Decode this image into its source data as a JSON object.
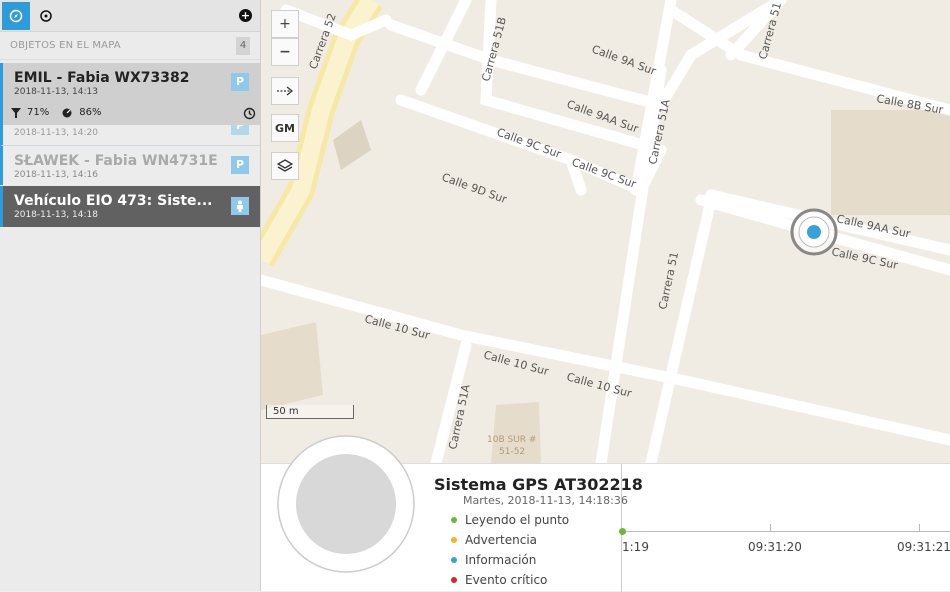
{
  "sidebar": {
    "section_label": "OBJETOS EN EL MAPA",
    "count": "4",
    "items": [
      {
        "name": "EMIL - Fabia WX73382",
        "time": "2018-11-13, 14:13",
        "badge": "P",
        "signal": "71%",
        "battery": "86%"
      },
      {
        "name": "",
        "time": "2018-11-13, 14:20",
        "badge": "P"
      },
      {
        "name": "SŁAWEK - Fabia WN4731E",
        "time": "2018-11-13, 14:16",
        "badge": "P"
      },
      {
        "name": "Vehículo EIO 473: Siste...",
        "time": "2018-11-13, 14:18"
      }
    ]
  },
  "map": {
    "zoom_in": "+",
    "zoom_out": "−",
    "gm_label": "GM",
    "scale_label": "50 m",
    "streets": [
      "Carrera 52",
      "Calle 9A Sur",
      "Calle 9AA Sur",
      "Carrera 51B",
      "Carrera 51",
      "Calle 8B Sur",
      "Carrera 51A",
      "Calle 9C Sur",
      "Calle 9C Sur",
      "Calle 9D Sur",
      "Calle 9AA Sur",
      "Calle 9C Sur",
      "Carrera 51",
      "Calle 10 Sur",
      "Calle 10 Sur",
      "Calle 10 Sur",
      "Carrera 51A"
    ],
    "building_label_1": "10B SUR #",
    "building_label_2": "51-52"
  },
  "panel": {
    "title": "Sistema GPS AT302218",
    "subtitle": "Martes, 2018-11-13, 14:18:36",
    "legend": [
      {
        "label": "Leyendo el punto",
        "color": "#6fb63a"
      },
      {
        "label": "Advertencia",
        "color": "#f0b429"
      },
      {
        "label": "Información",
        "color": "#3aa1d8"
      },
      {
        "label": "Evento crítico",
        "color": "#d9262a"
      }
    ],
    "ticks": [
      "1:19",
      "09:31:20",
      "09:31:21"
    ]
  }
}
